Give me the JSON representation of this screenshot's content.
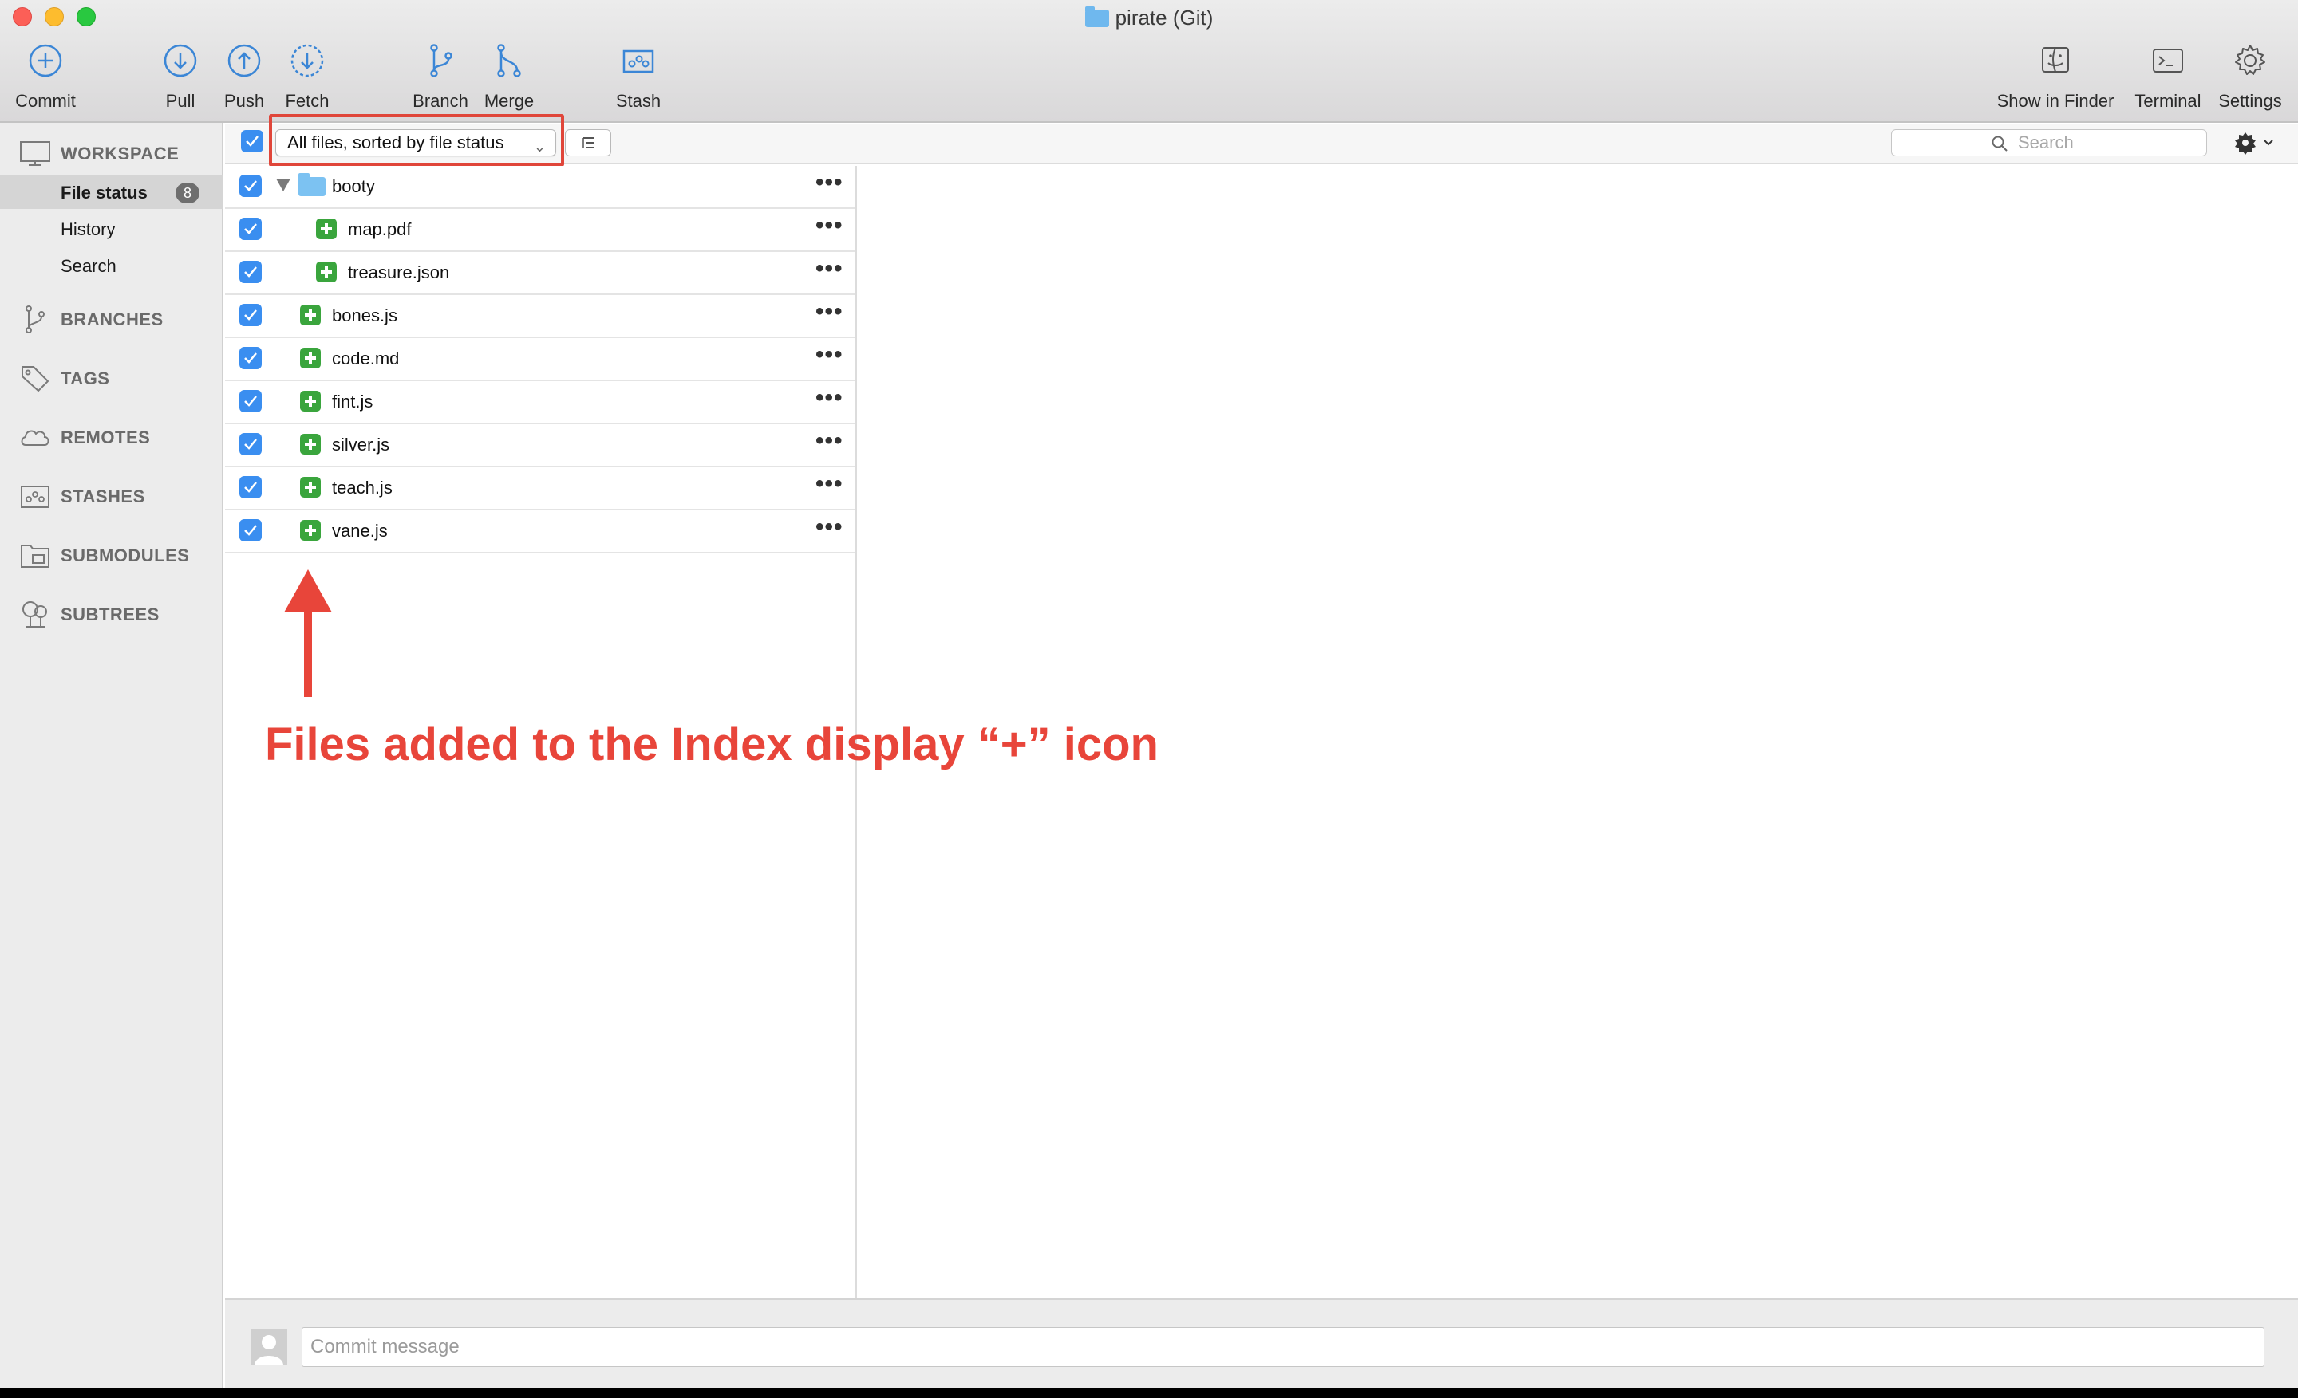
{
  "window": {
    "title": "pirate (Git)"
  },
  "toolbar": {
    "commit": "Commit",
    "pull": "Pull",
    "push": "Push",
    "fetch": "Fetch",
    "branch": "Branch",
    "merge": "Merge",
    "stash": "Stash",
    "show_in_finder": "Show in Finder",
    "terminal": "Terminal",
    "settings": "Settings"
  },
  "sidebar": {
    "workspace": "WORKSPACE",
    "items": [
      {
        "label": "File status",
        "badge": "8"
      },
      {
        "label": "History"
      },
      {
        "label": "Search"
      }
    ],
    "sections": [
      "BRANCHES",
      "TAGS",
      "REMOTES",
      "STASHES",
      "SUBMODULES",
      "SUBTREES"
    ]
  },
  "filter": {
    "selected": "All files, sorted by file status",
    "search_placeholder": "Search"
  },
  "files": [
    {
      "name": "booty",
      "type": "folder"
    },
    {
      "name": "map.pdf",
      "type": "added"
    },
    {
      "name": "treasure.json",
      "type": "added"
    },
    {
      "name": "bones.js",
      "type": "added"
    },
    {
      "name": "code.md",
      "type": "added"
    },
    {
      "name": "fint.js",
      "type": "added"
    },
    {
      "name": "silver.js",
      "type": "added"
    },
    {
      "name": "teach.js",
      "type": "added"
    },
    {
      "name": "vane.js",
      "type": "added"
    }
  ],
  "more_glyph": "•••",
  "annotation": {
    "text": "Files added to the Index display “+” icon"
  },
  "commit": {
    "placeholder": "Commit message"
  },
  "colors": {
    "accent": "#3a8ef0",
    "added": "#3aa53d",
    "annotation": "#e8453a"
  }
}
